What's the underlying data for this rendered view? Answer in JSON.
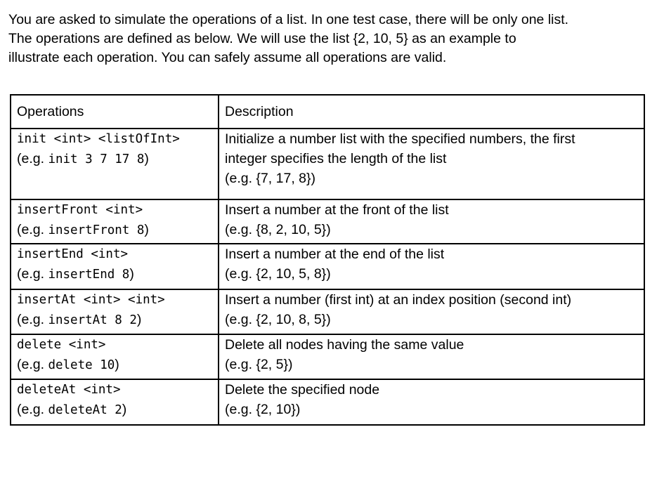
{
  "intro": {
    "lines": [
      "You are asked to simulate the operations of a list. In one test case, there will be only one list.",
      "The operations are defined as below. We will use the list {2, 10, 5} as an example to",
      "illustrate each operation. You can safely assume all operations are valid."
    ]
  },
  "table": {
    "headers": [
      "Operations",
      "Description"
    ],
    "rows": [
      {
        "syntax": "init <int> <listOfInt>",
        "example_prefix": "(e.g. ",
        "example_code": "init 3 7 17 8",
        "example_suffix": ")",
        "description_lines": [
          "Initialize a number list with the specified numbers, the first",
          "integer specifies the length of the list",
          "(e.g. {7, 17, 8})"
        ]
      },
      {
        "syntax": "insertFront <int>",
        "example_prefix": "(e.g. ",
        "example_code": "insertFront 8",
        "example_suffix": ")",
        "description_lines": [
          "Insert a number at the front of the list",
          "(e.g. {8, 2, 10, 5})"
        ]
      },
      {
        "syntax": "insertEnd <int>",
        "example_prefix": "(e.g. ",
        "example_code": "insertEnd 8",
        "example_suffix": ")",
        "description_lines": [
          "Insert a number at the end of the list",
          "(e.g. {2, 10, 5, 8})"
        ]
      },
      {
        "syntax": "insertAt <int> <int>",
        "example_prefix": "(e.g. ",
        "example_code": "insertAt 8 2",
        "example_suffix": ")",
        "description_lines": [
          "Insert a number (first int) at an index position (second int)",
          "(e.g. {2, 10, 8, 5})"
        ]
      },
      {
        "syntax": "delete <int>",
        "example_prefix": "(e.g. ",
        "example_code": "delete 10",
        "example_suffix": ")",
        "description_lines": [
          "Delete all nodes having the same value",
          "(e.g. {2, 5})"
        ]
      },
      {
        "syntax": "deleteAt <int>",
        "example_prefix": "(e.g. ",
        "example_code": "deleteAt 2",
        "example_suffix": ")",
        "description_lines": [
          "Delete the specified node",
          "(e.g. {2, 10})"
        ]
      }
    ]
  }
}
